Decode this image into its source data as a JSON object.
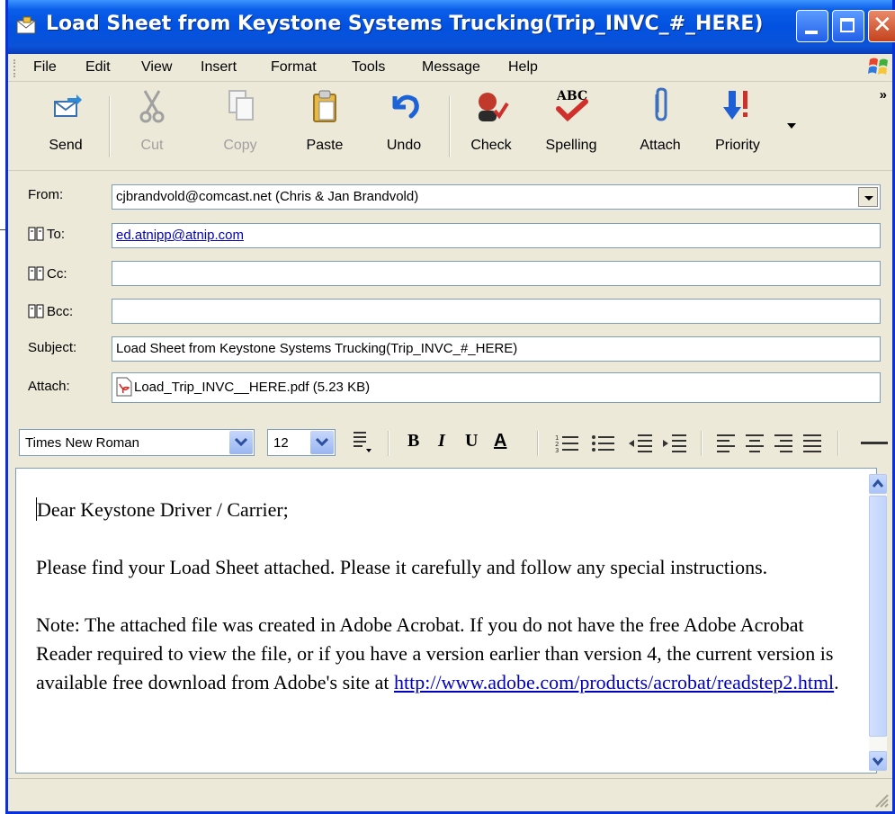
{
  "window": {
    "title": "Load Sheet from Keystone Systems Trucking(Trip_INVC_#_HERE)"
  },
  "menu": {
    "items": [
      "File",
      "Edit",
      "View",
      "Insert",
      "Format",
      "Tools",
      "Message",
      "Help"
    ]
  },
  "toolbar": {
    "send": "Send",
    "cut": "Cut",
    "copy": "Copy",
    "paste": "Paste",
    "undo": "Undo",
    "check": "Check",
    "spelling": "Spelling",
    "attach": "Attach",
    "priority": "Priority",
    "overflow": "»"
  },
  "headers": {
    "from_label": "From:",
    "from_value": "cjbrandvold@comcast.net   (Chris & Jan Brandvold)",
    "to_label": "To:",
    "to_value": "ed.atnipp@atnip.com",
    "cc_label": "Cc:",
    "cc_value": "",
    "bcc_label": "Bcc:",
    "bcc_value": "",
    "subject_label": "Subject:",
    "subject_value": "Load Sheet from Keystone Systems Trucking(Trip_INVC_#_HERE)",
    "attach_label": "Attach:",
    "attach_value": "Load_Trip_INVC__HERE.pdf (5.23 KB)"
  },
  "format": {
    "font": "Times New Roman",
    "size": "12",
    "bold": "B",
    "italic": "I",
    "underline": "U",
    "font_color": "A"
  },
  "message": {
    "greeting": "Dear Keystone Driver / Carrier;",
    "para1": "Please find your Load Sheet attached.  Please it carefully and follow any special instructions.",
    "para2": "Note: The attached file was created in Adobe Acrobat. If you do not have the free Adobe Acrobat Reader required to view the file, or if you have a version earlier than version 4, the current version is available free download from Adobe's site at",
    "link": "http://www.adobe.com/products/acrobat/readstep2.html",
    "link_tail": "."
  },
  "colors": {
    "titlebar": "#0251e0",
    "chrome": "#ece9d8",
    "link": "#0000c0"
  }
}
